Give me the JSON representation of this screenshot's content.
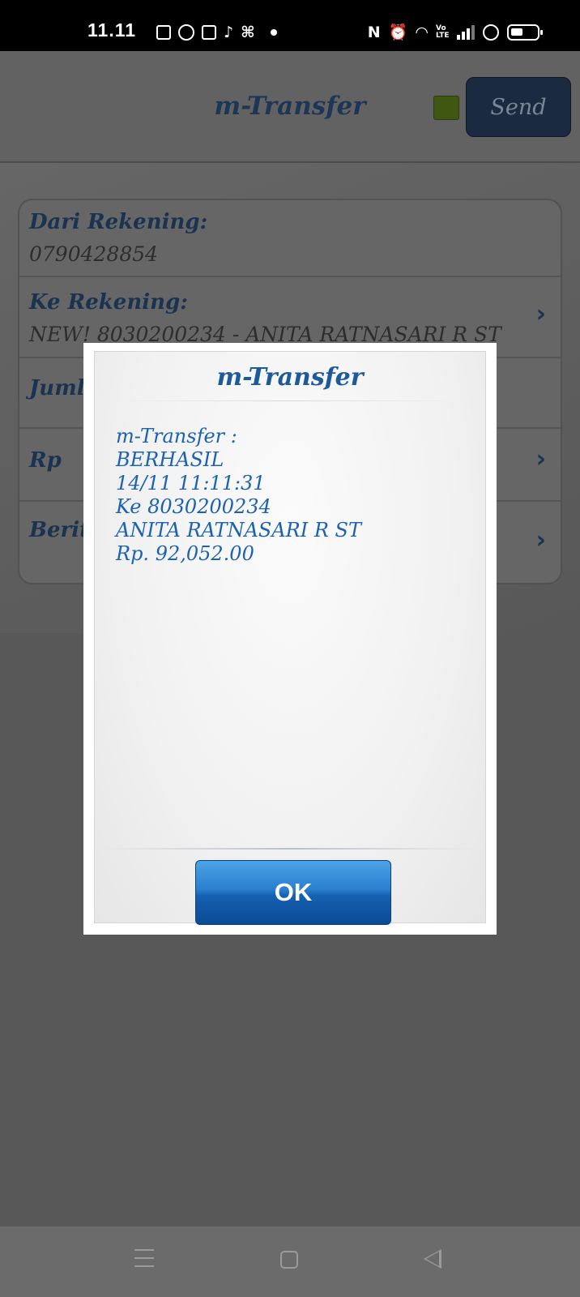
{
  "status_bar": {
    "time": "11.11",
    "left_icons": [
      "news-icon",
      "whatsapp-icon",
      "shop-icon",
      "tiktok-icon",
      "capcut-icon",
      "dot-icon"
    ],
    "right_icons": [
      "nfc-icon",
      "alarm-icon",
      "wifi-icon",
      "volte-icon",
      "signal-icon",
      "vpn-shield-icon",
      "battery-icon"
    ],
    "nfc_label": "N",
    "volte_label": "Vo LTE"
  },
  "header": {
    "title": "m-Transfer",
    "send_label": "Send",
    "indicator_color": "#3f5710"
  },
  "form": {
    "rows": [
      {
        "label": "Dari Rekening:",
        "value": "0790428854"
      },
      {
        "label": "Ke Rekening:",
        "value": "NEW! 8030200234 - ANITA RATNASARI R ST"
      },
      {
        "label": "Jumlah",
        "value": ""
      },
      {
        "label": "Rp",
        "value": ""
      },
      {
        "label": "Berita:",
        "value": ""
      }
    ],
    "chevron": "›"
  },
  "dialog": {
    "title": "m-Transfer",
    "message_lines": [
      "m-Transfer :",
      "BERHASIL",
      "14/11 11:11:31",
      "Ke 8030200234",
      "ANITA RATNASARI R ST",
      "Rp. 92,052.00"
    ],
    "ok_label": "OK",
    "accent_color": "#1b62b2"
  },
  "nav_bar": {
    "buttons": [
      "menu-icon",
      "home-icon",
      "back-icon"
    ]
  }
}
